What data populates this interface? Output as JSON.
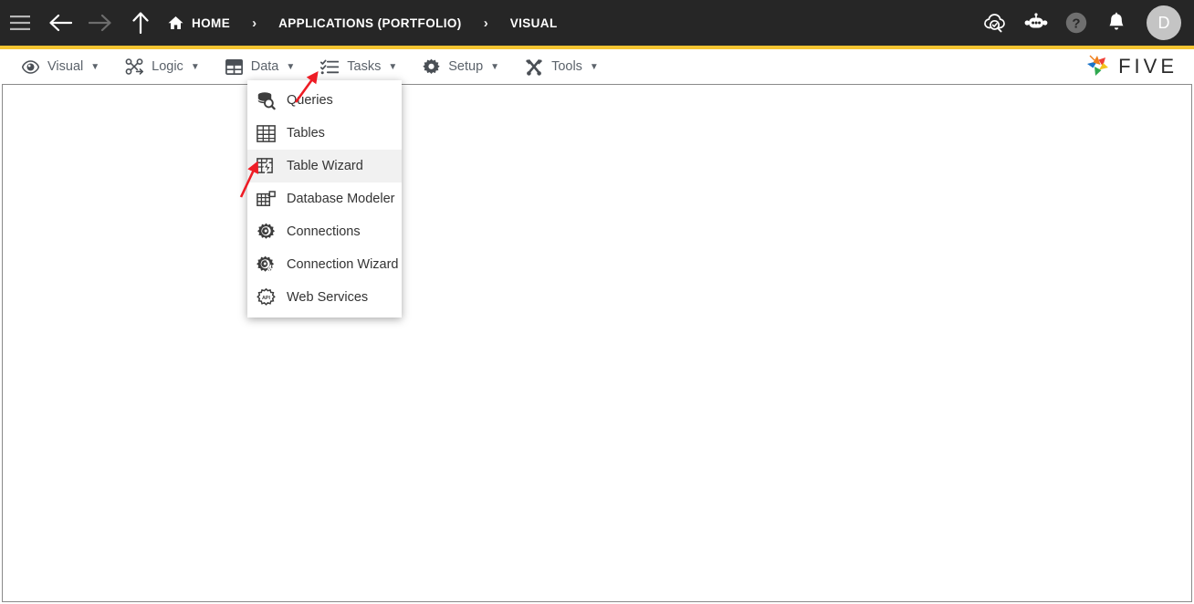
{
  "topbar": {
    "nav": [
      {
        "name": "menu-toggle",
        "icon": "hamburger-icon",
        "label": "Menu"
      },
      {
        "name": "back-button",
        "icon": "arrow-left-icon",
        "label": "Back"
      },
      {
        "name": "forward-button",
        "icon": "arrow-right-icon",
        "label": "Forward"
      },
      {
        "name": "up-button",
        "icon": "arrow-up-icon",
        "label": "Up"
      }
    ],
    "breadcrumb": [
      {
        "label": "HOME",
        "icon": "home-icon"
      },
      {
        "label": "APPLICATIONS (PORTFOLIO)",
        "icon": ""
      },
      {
        "label": "VISUAL",
        "icon": ""
      }
    ],
    "separator": "›",
    "actions": [
      {
        "name": "cloud-search-icon",
        "label": "Cloud"
      },
      {
        "name": "chat-bot-icon",
        "label": "Assistant"
      },
      {
        "name": "help-icon",
        "label": "Help"
      },
      {
        "name": "notifications-bell-icon",
        "label": "Notifications"
      }
    ],
    "avatar": "D",
    "background": "#262626",
    "accent": "#f5c431"
  },
  "menubar": {
    "items": [
      {
        "label": "Visual",
        "icon": "eye-icon",
        "caret": "▼"
      },
      {
        "label": "Logic",
        "icon": "logic-nodes-icon",
        "caret": "▼"
      },
      {
        "label": "Data",
        "icon": "table-grid-icon",
        "caret": "▼"
      },
      {
        "label": "Tasks",
        "icon": "checklist-icon",
        "caret": "▼"
      },
      {
        "label": "Setup",
        "icon": "gear-icon",
        "caret": "▼"
      },
      {
        "label": "Tools",
        "icon": "wrench-screwdriver-icon",
        "caret": "▼"
      }
    ],
    "brand": "FIVE"
  },
  "dropdown": {
    "owner": "Data",
    "items": [
      {
        "label": "Queries",
        "icon": "database-search-icon",
        "active": false
      },
      {
        "label": "Tables",
        "icon": "table-grid-icon",
        "active": false
      },
      {
        "label": "Table Wizard",
        "icon": "table-wizard-icon",
        "active": true
      },
      {
        "label": "Database Modeler",
        "icon": "database-modeler-icon",
        "active": false
      },
      {
        "label": "Connections",
        "icon": "connections-gear-icon",
        "active": false
      },
      {
        "label": "Connection Wizard",
        "icon": "connection-wizard-icon",
        "active": false
      },
      {
        "label": "Web Services",
        "icon": "api-badge-icon",
        "active": false
      }
    ]
  },
  "annotations": [
    {
      "name": "arrow-to-data-menu",
      "target": "Data",
      "color": "#ee1c25"
    },
    {
      "name": "arrow-to-table-wizard",
      "target": "Table Wizard",
      "color": "#ee1c25"
    }
  ]
}
